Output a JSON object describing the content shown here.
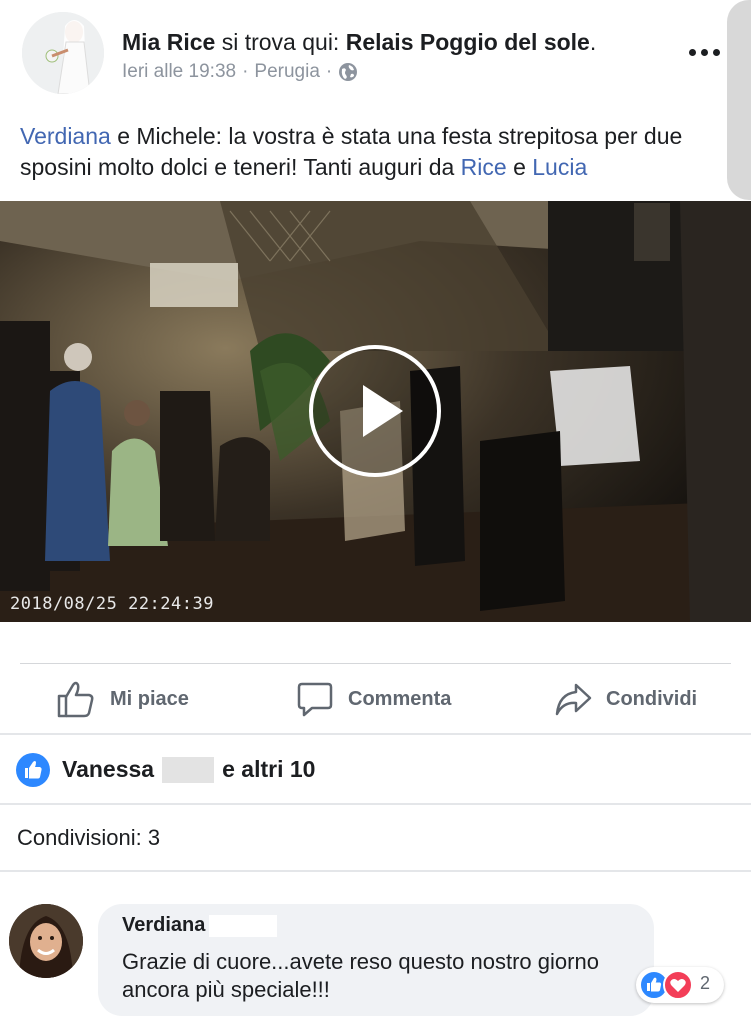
{
  "post": {
    "author": "Mia Rice",
    "location_prefix": "si trova qui:",
    "location_name": "Relais Poggio del sole",
    "location_suffix": ".",
    "time": "Ieri alle 19:38",
    "place": "Perugia",
    "separator": "·",
    "privacy_icon": "globe-icon",
    "text_parts": [
      {
        "text": "Verdiana",
        "link": true
      },
      {
        "text": " e Michele: la vostra è stata una festa strepitosa per due sposini molto dolci e teneri! Tanti auguri da ",
        "link": false
      },
      {
        "text": "Rice",
        "link": true
      },
      {
        "text": " e ",
        "link": false
      },
      {
        "text": "Lucia",
        "link": true
      }
    ]
  },
  "video": {
    "timestamp": "2018/08/25 22:24:39",
    "play_icon": "play-icon"
  },
  "actions": {
    "like": "Mi piace",
    "comment": "Commenta",
    "share": "Condividi"
  },
  "reactions": {
    "first_name": "Vanessa",
    "others": "e altri 10"
  },
  "shares": {
    "label": "Condivisioni: 3"
  },
  "comment": {
    "author": "Verdiana",
    "text": "Grazie di cuore...avete reso questo nostro giorno ancora più speciale!!!",
    "reaction_count": "2"
  },
  "colors": {
    "link": "#4267b2",
    "like_blue": "#2d88ff",
    "love_red": "#f33e58",
    "muted": "#606770"
  }
}
